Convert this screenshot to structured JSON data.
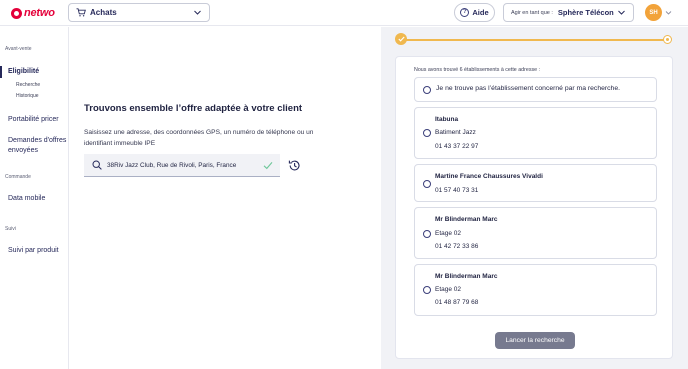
{
  "header": {
    "logo_text": "netwo",
    "module": "Achats",
    "help_label": "Aide",
    "act_as_prefix": "Agir en tant que :",
    "act_as_value": "Sphère Télécon",
    "avatar_initials": "SH"
  },
  "sidebar": {
    "section1": "Avant-vente",
    "eligibility": "Eligibilité",
    "sub_search": "Recherche",
    "sub_history": "Historique",
    "portability": "Portabilité pricer",
    "offers_requests": "Demandes d'offres envoyées",
    "section2": "Commande",
    "data_mobile": "Data mobile",
    "section3": "Suivi",
    "tracking": "Suivi par produit"
  },
  "main": {
    "title": "Trouvons ensemble l’offre adaptée à votre client",
    "description": "Saisissez une adresse, des coordonnées GPS, un numéro de téléphone ou un identifiant immeuble IPE",
    "address_value": "38Riv Jazz Club, Rue de Rivoli, Paris, France"
  },
  "results": {
    "found_text": "Nous avons trouvé 6 établissements à cette adresse :",
    "not_found_option": "Je ne trouve pas l’établissement concerné par ma recherche.",
    "establishments": [
      {
        "name": "Itabuna",
        "detail": "Batiment Jazz",
        "phone": "01 43 37 22 97"
      },
      {
        "name": "Martine France Chaussures Vivaldi",
        "detail": "",
        "phone": "01 57 40 73 31"
      },
      {
        "name": "Mr Blinderman Marc",
        "detail": "Etage 02",
        "phone": "01 42 72 33 86"
      },
      {
        "name": "Mr Blinderman Marc",
        "detail": "Etage 02",
        "phone": "01 48 87 79 68"
      }
    ],
    "launch_button": "Lancer la recherche"
  },
  "colors": {
    "accent_orange": "#f0b84f",
    "brand_red": "#e4003a",
    "navy": "#26295a"
  }
}
